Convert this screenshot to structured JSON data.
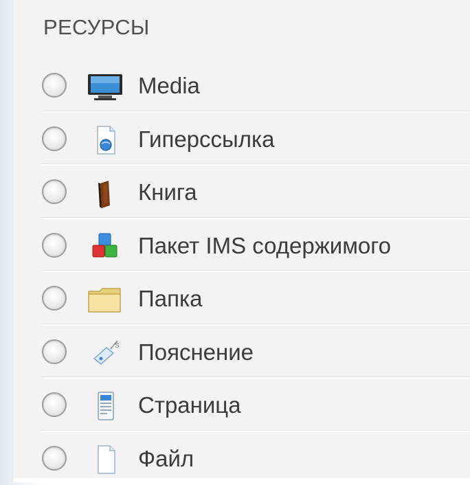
{
  "section": {
    "title": "РЕСУРСЫ"
  },
  "items": [
    {
      "label": "Media",
      "icon": "monitor-icon",
      "selected": false
    },
    {
      "label": "Гиперссылка",
      "icon": "hyperlink-icon",
      "selected": false
    },
    {
      "label": "Книга",
      "icon": "book-icon",
      "selected": false
    },
    {
      "label": "Пакет IMS содержимого",
      "icon": "ims-package-icon",
      "selected": false
    },
    {
      "label": "Папка",
      "icon": "folder-icon",
      "selected": false
    },
    {
      "label": "Пояснение",
      "icon": "label-tag-icon",
      "selected": false
    },
    {
      "label": "Страница",
      "icon": "page-icon",
      "selected": false
    },
    {
      "label": "Файл",
      "icon": "file-icon",
      "selected": false
    }
  ]
}
